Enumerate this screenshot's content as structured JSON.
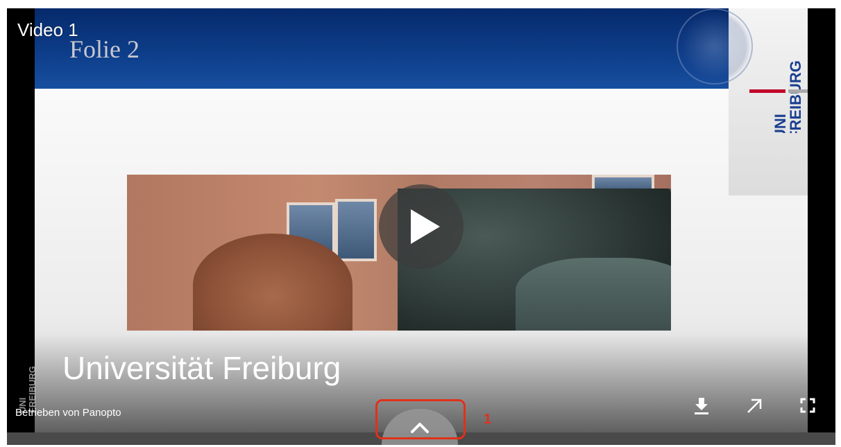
{
  "player": {
    "video_label": "Video 1",
    "powered_by": "Betrieben von Panopto"
  },
  "slide": {
    "title": "Folie 2",
    "big_title": "Universität Freiburg",
    "logo_lines": [
      "UNI",
      "FREIBURG"
    ]
  },
  "controls": {
    "download_icon": "download-icon",
    "popout_icon": "external-link-icon",
    "fullscreen_icon": "fullscreen-icon",
    "expand_icon": "chevron-up-icon",
    "play_icon": "play-icon"
  },
  "annotation": {
    "number": "1",
    "color": "#e0311a"
  },
  "colors": {
    "header_blue": "#0e3f8c",
    "logo_blue": "#1a3f8f",
    "logo_red": "#c1002a"
  }
}
